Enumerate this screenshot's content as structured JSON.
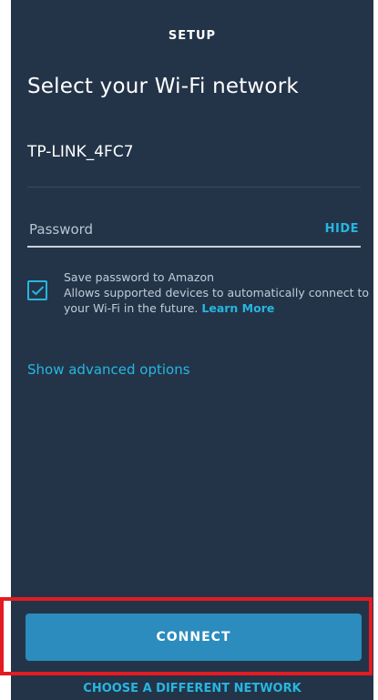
{
  "header": {
    "title": "SETUP"
  },
  "main": {
    "title": "Select your Wi-Fi network",
    "network_name": "TP-LINK_4FC7",
    "password": {
      "value": "",
      "placeholder": "Password",
      "toggle_label": "HIDE"
    },
    "save_password": {
      "checked": true,
      "title": "Save password to Amazon",
      "description": "Allows supported devices to automatically connect to your Wi-Fi in the future.",
      "link_label": "Learn More"
    },
    "advanced_options_label": "Show advanced options"
  },
  "footer": {
    "connect_label": "CONNECT",
    "different_network_label": "CHOOSE A DIFFERENT NETWORK"
  },
  "colors": {
    "background": "#233449",
    "accent": "#27b6e0",
    "button": "#2b8cbd",
    "highlight_frame": "#e31b23"
  },
  "icons": {
    "checkbox": "check-icon"
  }
}
